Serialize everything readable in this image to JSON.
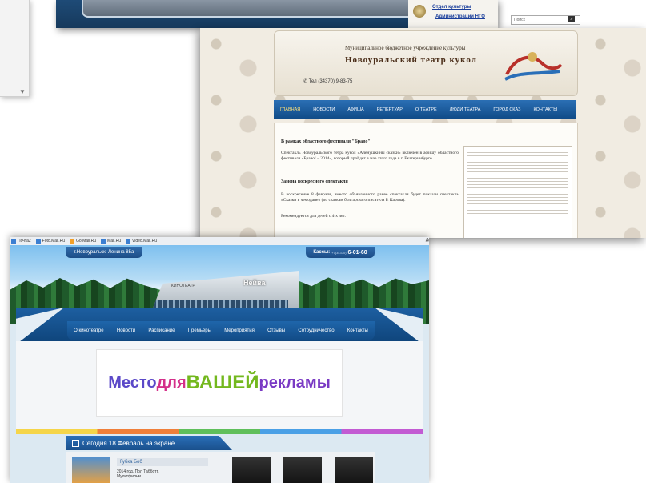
{
  "top_strip": {
    "link1": "Отдел культуры",
    "link2": "Администрации НГО"
  },
  "theatre": {
    "search_placeholder": "Поиск",
    "org": "Муниципальное бюджетное учреждение культуры",
    "name": "Новоуральский театр кукол",
    "phone": "Тел (34370) 9-83-75",
    "nav": [
      "ГЛАВНАЯ",
      "НОВОСТИ",
      "АФИША",
      "РЕПЕРТУАР",
      "О ТЕАТРЕ",
      "ЛЮДИ ТЕАТРА",
      "ГОРОД СКАЗ",
      "КОНТАКТЫ"
    ],
    "article1_title": "В рамках областного фестиваля \"Браво\"",
    "article1_text": "Спектакль Новоуральского тетра кукол «Алёнушкины сказки» включен в афишу областного фестиваля «Браво! – 2014», который пройдет в мае этого года в г. Екатеринбурге.",
    "article2_title": "Замена воскресного спектакля",
    "article2_text": "В воскресенье 8 февраля, вместо объявленного ранее спектакля будет показан спектакль «Сказки в чемодане» (по сказкам болгарского писателя Р. Карова).",
    "article2_note": "Рекомендуется для детей с 4-х лет."
  },
  "cinema": {
    "toolbar": [
      "Почта2",
      "Foto.Mail.Ru",
      "Go.Mail.Ru",
      "Mail.Ru",
      "Video.Mail.Ru"
    ],
    "toolbar_right": "Дп",
    "address": "г.Новоуральск, Ленина 85а",
    "cash_label": "Кассы:",
    "cash_code": "+7(34370)",
    "cash_number": "6-01-60",
    "sign_small": "КИНОТЕАТР",
    "sign_big": "Нейва",
    "nav": [
      "О кинотеатре",
      "Новости",
      "Расписание",
      "Премьеры",
      "Мероприятия",
      "Отзывы",
      "Сотрудничество",
      "Контакты"
    ],
    "ad": {
      "w1": "Место",
      "w2": "для",
      "w3": "ВАШЕЙ",
      "w4": "рекламы"
    },
    "today": "Сегодня 18 Февраль на экране",
    "movie_title": "Губка Боб",
    "movie_meta1": "2014 год, Пол Табботт,",
    "movie_meta2": "Мультфильм"
  }
}
